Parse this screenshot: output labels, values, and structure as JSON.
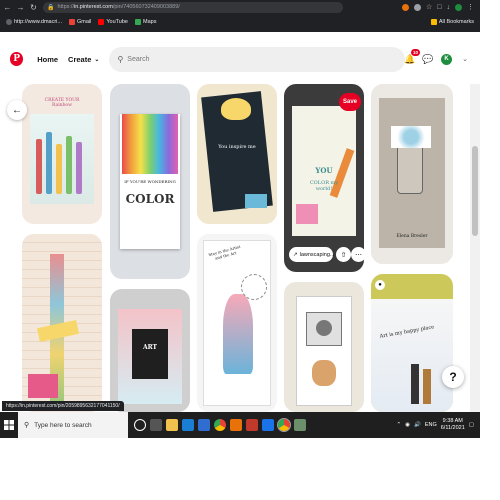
{
  "browser": {
    "url_prefix": "https://",
    "url_host": "in.pinterest.com",
    "url_path": "/pin/740560732409003889/",
    "bookmarks": [
      {
        "label": "http://www.dmacri...",
        "color": "#5f6368"
      },
      {
        "label": "Gmail",
        "color": "#ea4335"
      },
      {
        "label": "YouTube",
        "color": "#ff0000"
      },
      {
        "label": "Maps",
        "color": "#34a853"
      }
    ],
    "all_bookmarks": "All Bookmarks",
    "status_url": "https://in.pinterest.com/pin/2059895632177041150/"
  },
  "header": {
    "home": "Home",
    "create": "Create",
    "search_placeholder": "Search",
    "notification_count": "10",
    "avatar_initial": "K"
  },
  "pins": {
    "save": "Save",
    "link_chip": "lawnscaping...",
    "card_texts": {
      "c1": "CREATE YOUR Rainbow",
      "c2_a": "IF YOU'RE WONDERING",
      "c2_b": "COLOR",
      "c3": "You inspire me",
      "c4_a": "YOU",
      "c4_b": "COLOR my world!",
      "c6": "ART",
      "c7": "Stay in the Artist and the Art",
      "c8": "Art is my happy place",
      "c9": "Elena Bresler"
    }
  },
  "help_glyph": "?",
  "taskbar": {
    "search_placeholder": "Type here to search",
    "time": "9:38 AM",
    "date": "6/11/2021",
    "lang": "ENG"
  },
  "colors": {
    "pinterest_red": "#e60023",
    "chrome_dark": "#202124",
    "taskbar": "#1f1f1f"
  }
}
